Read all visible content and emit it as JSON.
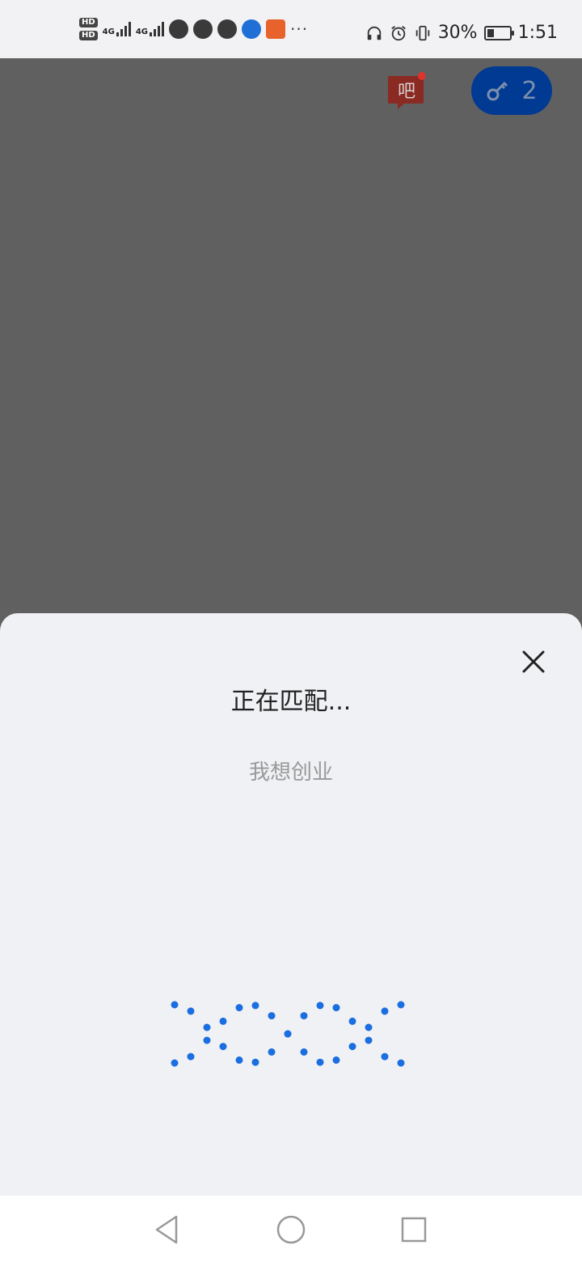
{
  "status_bar": {
    "sim1": "HD",
    "sim2": "HD",
    "net1": "4G",
    "net2": "4G",
    "battery_percent": "30%",
    "battery_level": 0.3,
    "time": "1:51",
    "more": "···"
  },
  "header": {
    "ba_icon_label": "吧",
    "key_count": "2",
    "key_badge_color": "#003a92",
    "notification_color": "#e0332c"
  },
  "sheet": {
    "title": "正在匹配...",
    "subtitle": "我想创业"
  },
  "loader": {
    "color": "#1a6ee0"
  },
  "nav": {
    "back": "back-icon",
    "home": "home-icon",
    "recents": "recents-icon"
  }
}
